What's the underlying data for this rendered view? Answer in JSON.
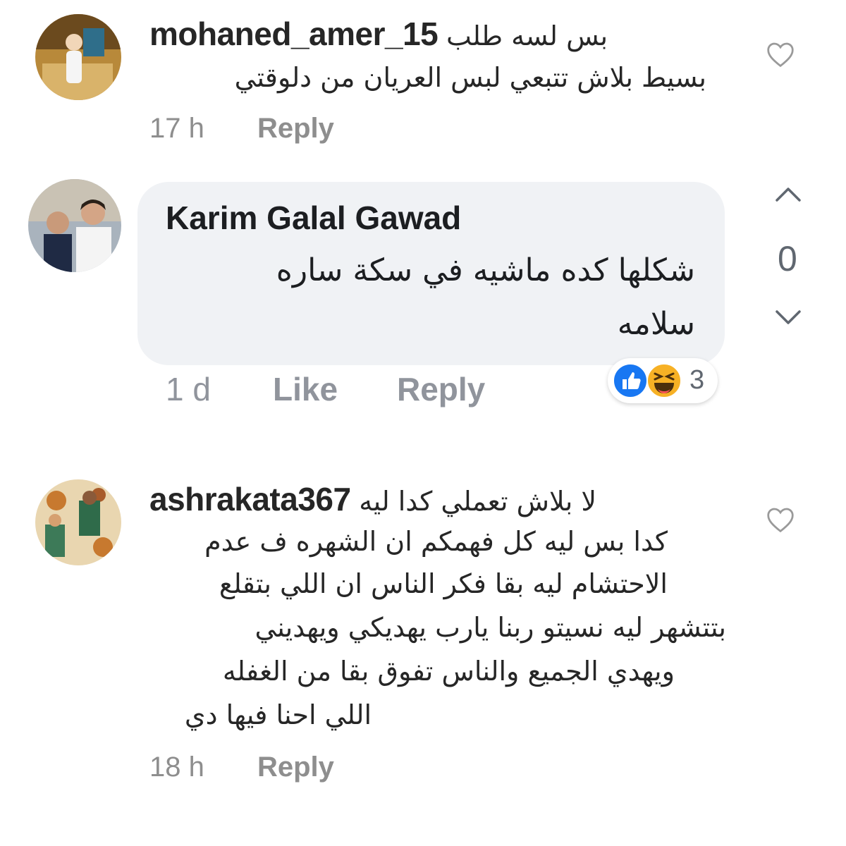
{
  "comments": [
    {
      "username": "mohaned_amer_15",
      "text_line1": "بس لسه طلب",
      "text_line2": "بسيط بلاش تتبعي لبس العريان من دلوقتي",
      "time": "17 h",
      "reply_label": "Reply"
    },
    {
      "username": "ashrakata367",
      "text_line1": "لا بلاش تعملي كدا ليه",
      "text_line2": "كدا بس ليه كل فهمكم ان الشهره ف عدم",
      "text_line3": "الاحتشام ليه بقا فكر الناس ان اللي بتقلع",
      "text_line4": "بتتشهر ليه نسيتو ربنا يارب يهديكي ويهديني",
      "text_line5": "ويهدي الجميع والناس تفوق بقا من الغفله",
      "text_line6": "اللي احنا فيها دي",
      "time": "18 h",
      "reply_label": "Reply"
    }
  ],
  "fb_comment": {
    "author": "Karim Galal Gawad",
    "text_line1": "شكلها كده ماشيه في سكة ساره",
    "text_line2": "سلامه",
    "time": "1 d",
    "like_label": "Like",
    "reply_label": "Reply",
    "reaction_count": "3",
    "vote_count": "0"
  },
  "icons": {
    "heart": "heart-outline-icon",
    "upvote": "chevron-up-icon",
    "downvote": "chevron-down-icon",
    "like_reaction": "like-reaction-icon",
    "haha_reaction": "haha-reaction-icon"
  },
  "colors": {
    "bubble": "#f0f2f5",
    "meta_gray": "#8e8e8e",
    "fb_like_blue": "#1877f2",
    "haha_yellow": "#f7b125"
  }
}
